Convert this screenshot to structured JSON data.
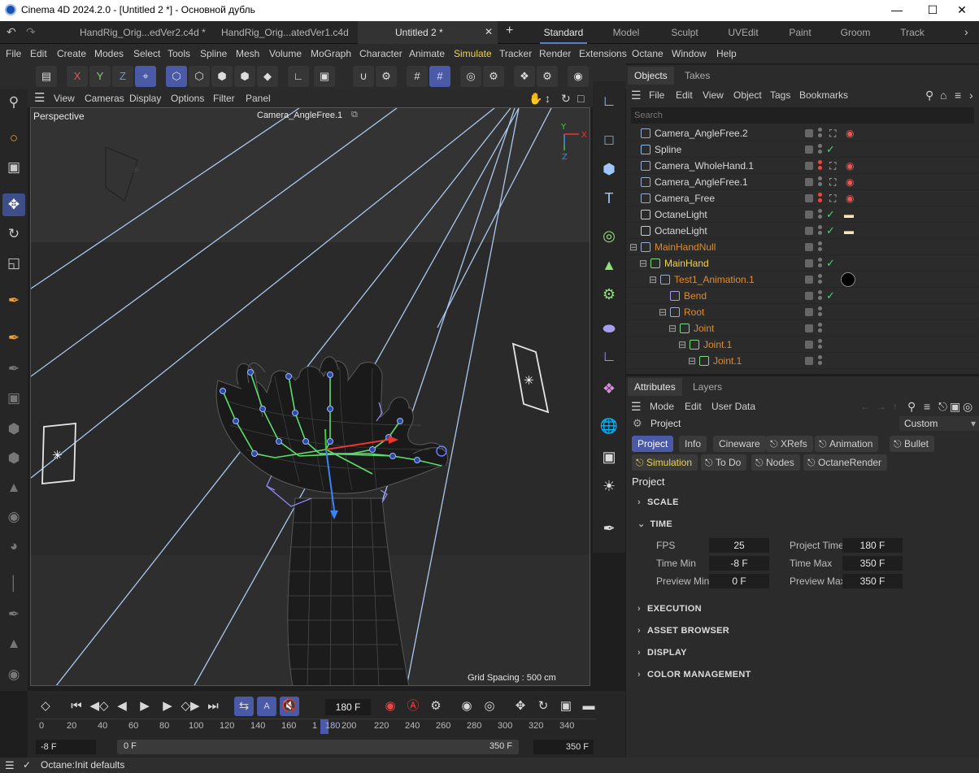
{
  "window": {
    "title": "Cinema 4D 2024.2.0 - [Untitled 2 *] - Основной дубль"
  },
  "doc_tabs": [
    "HandRig_Orig...edVer2.c4d *",
    "HandRig_Orig...atedVer1.c4d",
    "Untitled 2 *"
  ],
  "layouts": [
    "Standard",
    "Model",
    "Sculpt",
    "UVEdit",
    "Paint",
    "Groom",
    "Track"
  ],
  "menu": [
    "File",
    "Edit",
    "Create",
    "Modes",
    "Select",
    "Tools",
    "Spline",
    "Mesh",
    "Volume",
    "MoGraph",
    "Character",
    "Animate",
    "Simulate",
    "Tracker",
    "Render",
    "Extensions",
    "Octane",
    "Window",
    "Help"
  ],
  "toolbar": {
    "x": "X",
    "y": "Y",
    "z": "Z"
  },
  "viewport": {
    "menu": [
      "View",
      "Cameras",
      "Display",
      "Options",
      "Filter",
      "Panel"
    ],
    "name": "Perspective",
    "camera": "Camera_AngleFree.1",
    "grid_spacing": "Grid Spacing : 500 cm",
    "axis": {
      "y": "Y",
      "x": "X",
      "z": "Z"
    }
  },
  "objects_panel": {
    "tabs": [
      "Objects",
      "Takes"
    ],
    "menu": [
      "File",
      "Edit",
      "View",
      "Object",
      "Tags",
      "Bookmarks"
    ],
    "search_placeholder": "Search",
    "rows": [
      {
        "name": "Camera_AngleFree.2",
        "indent": 0,
        "color": "default"
      },
      {
        "name": "Spline",
        "indent": 0,
        "color": "default"
      },
      {
        "name": "Camera_WholeHand.1",
        "indent": 0,
        "color": "default"
      },
      {
        "name": "Camera_AngleFree.1",
        "indent": 0,
        "color": "default"
      },
      {
        "name": "Camera_Free",
        "indent": 0,
        "color": "default"
      },
      {
        "name": "OctaneLight",
        "indent": 0,
        "color": "default"
      },
      {
        "name": "OctaneLight",
        "indent": 0,
        "color": "default"
      },
      {
        "name": "MainHandNull",
        "indent": 0,
        "color": "orange"
      },
      {
        "name": "MainHand",
        "indent": 1,
        "color": "yellow"
      },
      {
        "name": "Test1_Animation.1",
        "indent": 2,
        "color": "orange"
      },
      {
        "name": "Bend",
        "indent": 3,
        "color": "orange"
      },
      {
        "name": "Root",
        "indent": 3,
        "color": "orange"
      },
      {
        "name": "Joint",
        "indent": 4,
        "color": "orange"
      },
      {
        "name": "Joint.1",
        "indent": 5,
        "color": "orange"
      },
      {
        "name": "Joint.1",
        "indent": 6,
        "color": "orange"
      }
    ]
  },
  "attributes_panel": {
    "tabs": [
      "Attributes",
      "Layers"
    ],
    "menu": [
      "Mode",
      "Edit",
      "User Data"
    ],
    "header": "Project",
    "preset": "Custom",
    "buttons_row1": [
      "Project",
      "Info",
      "Cineware",
      "XRefs",
      "Animation",
      "Bullet"
    ],
    "buttons_row2": [
      "Simulation",
      "To Do",
      "Nodes",
      "OctaneRender"
    ],
    "section_title": "Project",
    "sections": [
      "SCALE",
      "TIME",
      "EXECUTION",
      "ASSET BROWSER",
      "DISPLAY",
      "COLOR MANAGEMENT"
    ],
    "time": {
      "fps_label": "FPS",
      "fps": "25",
      "project_time_label": "Project Time",
      "project_time": "180 F",
      "time_min_label": "Time Min",
      "time_min": "-8 F",
      "time_max_label": "Time Max",
      "time_max": "350 F",
      "preview_min_label": "Preview Min",
      "preview_min": "0 F",
      "preview_max_label": "Preview Max",
      "preview_max": "350 F"
    }
  },
  "timeline": {
    "current_frame": "180 F",
    "ticks": [
      "0",
      "20",
      "40",
      "60",
      "80",
      "100",
      "120",
      "140",
      "160",
      "1",
      "180",
      "200",
      "220",
      "240",
      "260",
      "280",
      "300",
      "320",
      "340"
    ],
    "start": "-8 F",
    "preview_start": "0 F",
    "preview_end": "350 F",
    "end": "350 F"
  },
  "status": "Octane:Init defaults"
}
